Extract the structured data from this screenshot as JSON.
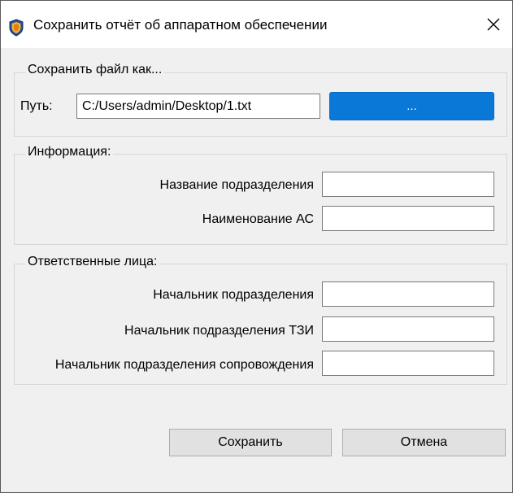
{
  "window": {
    "title": "Сохранить отчёт об аппаратном обеспечении",
    "app_icon": "shield-icon",
    "close_icon": "close-icon"
  },
  "save_group": {
    "title": "Сохранить файл как...",
    "path_label": "Путь:",
    "path_value": "C:/Users/admin/Desktop/1.txt",
    "browse_label": "..."
  },
  "info_group": {
    "title": "Информация:",
    "fields": [
      {
        "label": "Название подразделения",
        "value": ""
      },
      {
        "label": "Наименование АС",
        "value": ""
      }
    ]
  },
  "people_group": {
    "title": "Ответственные лица:",
    "fields": [
      {
        "label": "Начальник подразделения",
        "value": ""
      },
      {
        "label": "Начальник подразделения ТЗИ",
        "value": ""
      },
      {
        "label": "Начальник подразделения сопровождения",
        "value": ""
      }
    ]
  },
  "buttons": {
    "save": "Сохранить",
    "cancel": "Отмена"
  },
  "colors": {
    "accent": "#0a78d7",
    "dialog_bg": "#f0f0f0"
  }
}
